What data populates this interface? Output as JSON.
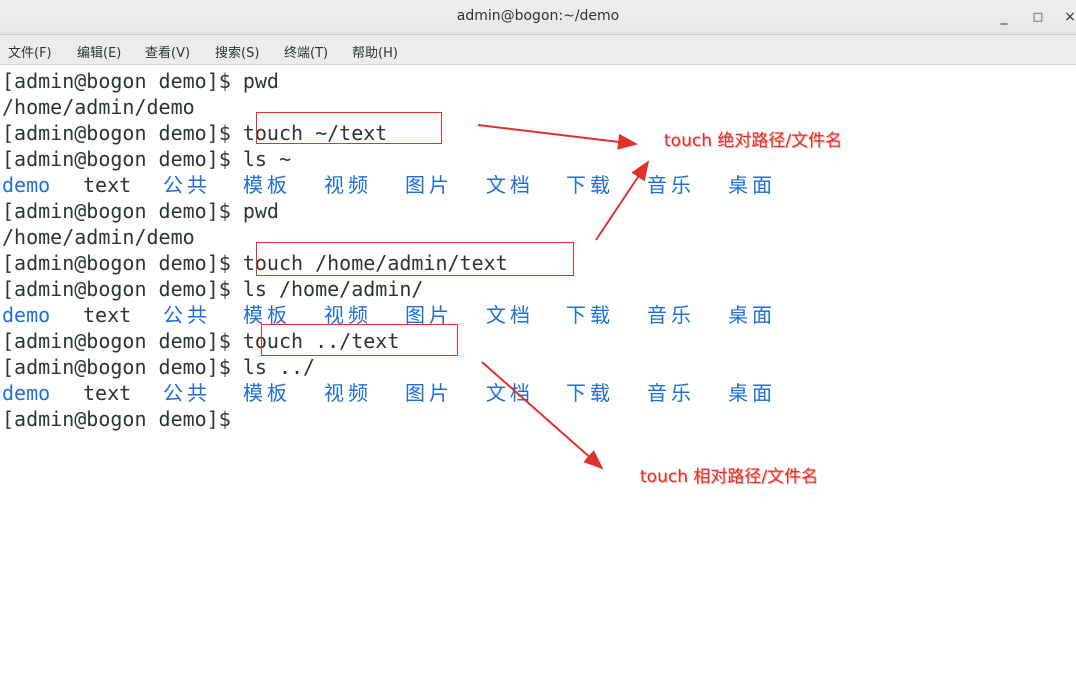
{
  "window": {
    "title": "admin@bogon:~/demo",
    "minimize_glyph": "_",
    "maximize_glyph": "□",
    "close_glyph": "×"
  },
  "menu": [
    {
      "label": "文件(F)"
    },
    {
      "label": "编辑(E)"
    },
    {
      "label": "查看(V)"
    },
    {
      "label": "搜索(S)"
    },
    {
      "label": "终端(T)"
    },
    {
      "label": "帮助(H)"
    }
  ],
  "terminal": {
    "lines": [
      "[admin@bogon demo]$ pwd",
      "/home/admin/demo",
      "[admin@bogon demo]$ touch ~/text",
      "[admin@bogon demo]$ ls ~",
      "",
      "[admin@bogon demo]$ pwd",
      "/home/admin/demo",
      "[admin@bogon demo]$ touch /home/admin/text",
      "[admin@bogon demo]$ ls /home/admin/",
      "",
      "[admin@bogon demo]$ touch ../text",
      "[admin@bogon demo]$ ls ../",
      "",
      "[admin@bogon demo]$ "
    ],
    "ls_output": [
      {
        "name": "demo",
        "color": "#1e6fd9"
      },
      {
        "name": "text",
        "color": "#2e3436"
      },
      {
        "name": "公共",
        "color": "#1e6fd9"
      },
      {
        "name": "模板",
        "color": "#1e6fd9"
      },
      {
        "name": "视频",
        "color": "#1e6fd9"
      },
      {
        "name": "图片",
        "color": "#1e6fd9"
      },
      {
        "name": "文档",
        "color": "#1e6fd9"
      },
      {
        "name": "下载",
        "color": "#1e6fd9"
      },
      {
        "name": "音乐",
        "color": "#1e6fd9"
      },
      {
        "name": "桌面",
        "color": "#1e6fd9"
      }
    ]
  },
  "annotations": {
    "absolute": "touch 绝对路径/文件名",
    "relative": "touch 相对路径/文件名",
    "color": "#e0312c"
  }
}
